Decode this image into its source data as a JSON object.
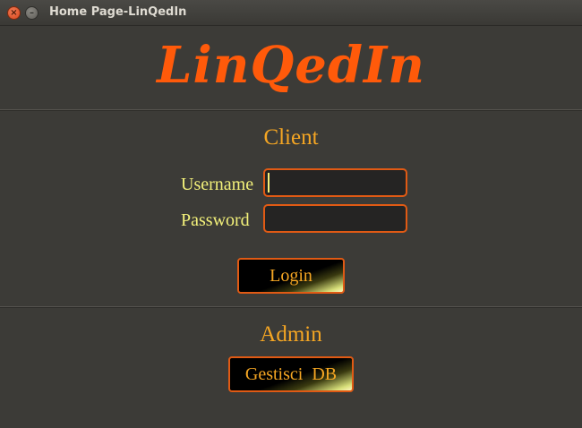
{
  "window": {
    "title": "Home Page-LinQedIn",
    "close_glyph": "×",
    "minimize_glyph": "–"
  },
  "logo": {
    "text": "LinQedIn"
  },
  "client": {
    "heading": "Client",
    "username_label": "Username",
    "username_value": "",
    "password_label": "Password",
    "password_value": "",
    "login_label": "Login"
  },
  "admin": {
    "heading": "Admin",
    "manage_db_label": "Gestisci  DB"
  },
  "colors": {
    "background": "#3c3b37",
    "logo": "#ff5a0a",
    "heading": "#f5a623",
    "label": "#f3f17a",
    "border": "#e05a14"
  }
}
